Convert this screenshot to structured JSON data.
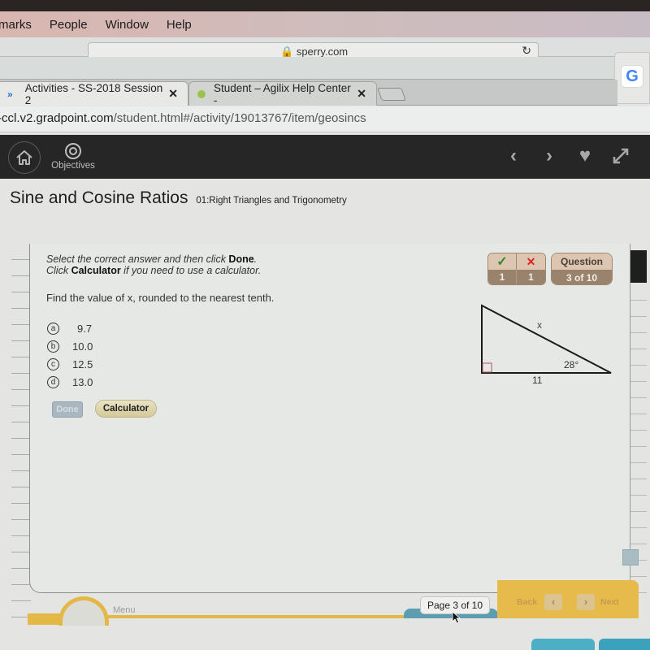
{
  "menubar": {
    "items": [
      "marks",
      "People",
      "Window",
      "Help"
    ]
  },
  "browser": {
    "top_omnibox_host": "sperry.com",
    "tabs": [
      {
        "title": "Activities - SS-2018 Session 2",
        "active": true,
        "favicon": "gradpoint-chevron-icon"
      },
      {
        "title": "Student – Agilix Help Center -",
        "active": false,
        "favicon": "agilix-leaf-icon"
      }
    ],
    "url_host": "-ccl.v2.gradpoint.com",
    "url_path": "/student.html#/activity/19013767/item/geosincs",
    "extension_label": "G"
  },
  "app_header": {
    "objectives_label": "Objectives"
  },
  "page": {
    "title": "Sine and Cosine Ratios",
    "subtitle": "01:Right Triangles and Trigonometry"
  },
  "question": {
    "instruction_part1": "Select the correct answer and then click ",
    "instruction_done": "Done",
    "instruction_end1": ".",
    "instruction_part2": "Click ",
    "instruction_calc": "Calculator",
    "instruction_end2": " if you need to use a calculator.",
    "prompt": "Find the value of x, rounded to the nearest tenth.",
    "choices": [
      {
        "letter": "a",
        "value": "9.7"
      },
      {
        "letter": "b",
        "value": "10.0"
      },
      {
        "letter": "c",
        "value": "12.5"
      },
      {
        "letter": "d",
        "value": "13.0"
      }
    ],
    "done_label": "Done",
    "calculator_label": "Calculator",
    "figure": {
      "hypotenuse_label": "x",
      "angle_label": "28°",
      "base_label": "11"
    }
  },
  "score": {
    "correct_icon": "✓",
    "incorrect_icon": "✕",
    "correct_count": "1",
    "incorrect_count": "1",
    "question_label": "Question",
    "question_progress": "3 of 10"
  },
  "footer": {
    "menu_label": "Menu",
    "page_indicator": "Page  3 of 10",
    "back_label": "Back",
    "next_label": "Next"
  },
  "colors": {
    "header_bg": "#262626",
    "accent_yellow": "#e4b847",
    "badge_brown": "#9a836c",
    "teal": "#5c9db2"
  }
}
